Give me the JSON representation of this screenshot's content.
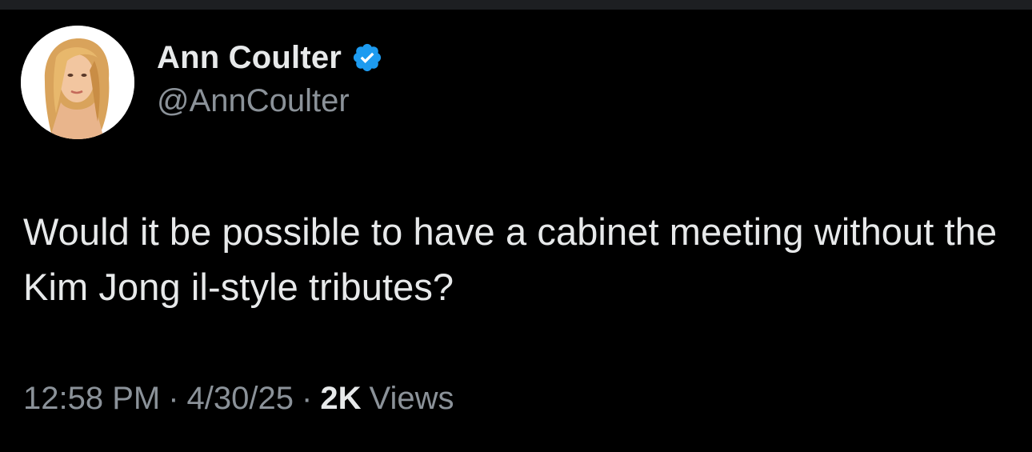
{
  "tweet": {
    "author": {
      "display_name": "Ann Coulter",
      "handle": "@AnnCoulter",
      "verified": true
    },
    "text": "Would it be possible to have a cabinet meeting without the Kim Jong il-style tributes?",
    "meta": {
      "time": "12:58 PM",
      "separator": "·",
      "date": "4/30/25",
      "views_count": "2K",
      "views_label": "Views"
    }
  },
  "colors": {
    "background": "#000000",
    "primary_text": "#e7e9ea",
    "secondary_text": "#8b9299",
    "verified_badge": "#1d9bf0"
  },
  "icons": {
    "verified": "verified-badge-icon",
    "avatar": "profile-photo"
  }
}
